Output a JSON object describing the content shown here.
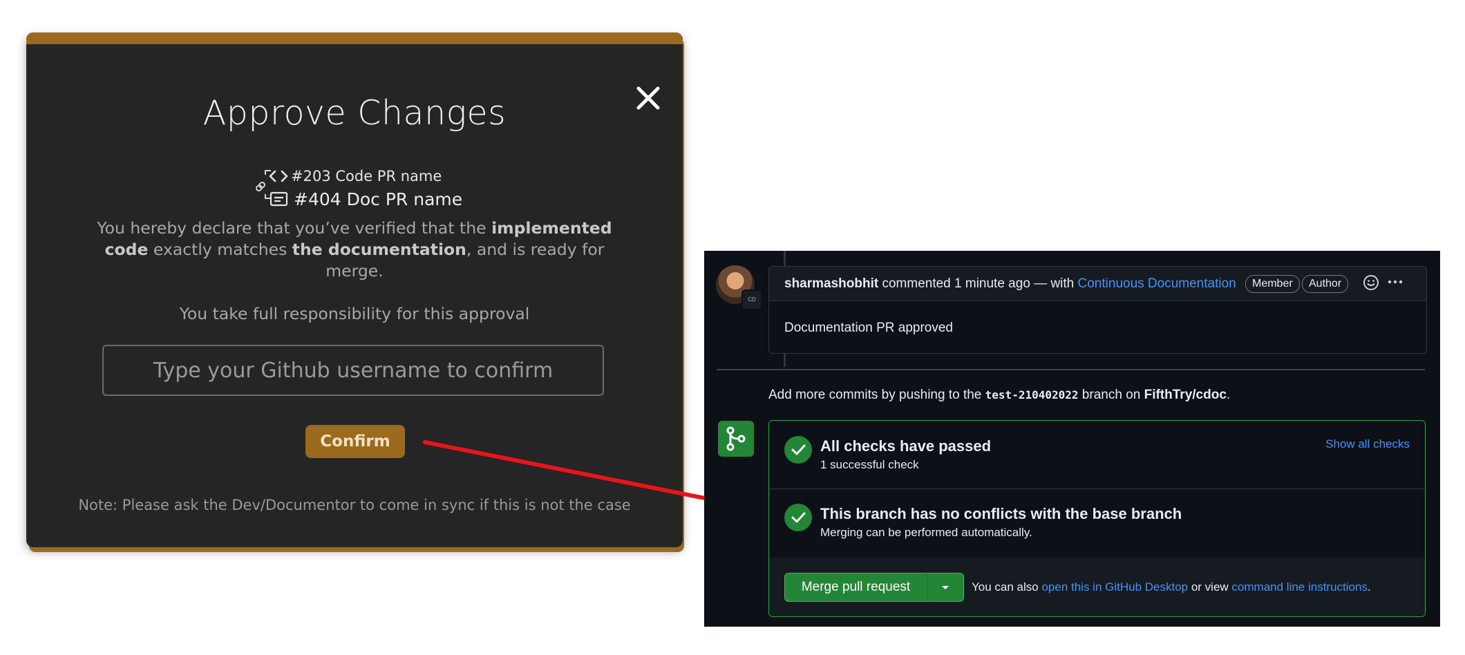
{
  "modal": {
    "title": "Approve Changes",
    "code_pr": "#203 Code PR name",
    "doc_pr": "#404 Doc PR name",
    "declaration": {
      "part1": "You hereby declare that you’ve verified that the ",
      "bold1": "implemented code",
      "part2": " exactly matches ",
      "bold2": "the  documentation",
      "part3": ", and is ready for merge."
    },
    "responsibility": "You take full responsibility for this approval",
    "username_placeholder": "Type your Github username to confirm",
    "confirm_label": "Confirm",
    "note": "Note: Please ask the Dev/Documentor to come in sync if this is not the case",
    "colors": {
      "accent": "#9b6a1f",
      "background": "#252525"
    }
  },
  "github": {
    "comment": {
      "author": "sharmashobhit",
      "action": " commented 1 minute ago — with ",
      "app": "Continuous Documentation",
      "badge_member": "Member",
      "badge_author": "Author",
      "body": "Documentation PR approved"
    },
    "add_commits": {
      "prefix": "Add more commits by pushing to the ",
      "branch": "test-210402022",
      "middle": " branch on ",
      "repo": "FifthTry/cdoc",
      "suffix": "."
    },
    "checks": {
      "title": "All checks have passed",
      "subtitle": "1 successful check",
      "link": "Show all checks"
    },
    "conflicts": {
      "title": "This branch has no conflicts with the base branch",
      "subtitle": "Merging can be performed automatically."
    },
    "merge": {
      "button": "Merge pull request",
      "note_prefix": "You can also ",
      "desktop_link": "open this in GitHub Desktop",
      "note_middle": " or view ",
      "cli_link": "command line instructions",
      "note_suffix": "."
    },
    "colors": {
      "success": "#238636",
      "link": "#4493f8",
      "background": "#0d1117"
    }
  },
  "annotation": {
    "arrow_color": "#e8141c"
  }
}
